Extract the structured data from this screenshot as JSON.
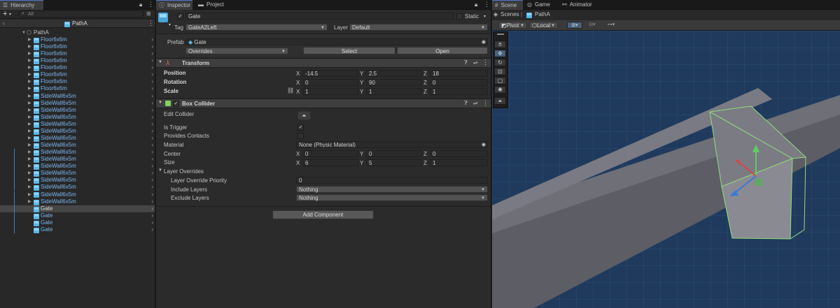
{
  "hierarchy": {
    "tab_label": "Hierarchy",
    "search_placeholder": "All",
    "scene_name": "PathA",
    "root": "PathA",
    "items": [
      {
        "label": "Floor6x6m"
      },
      {
        "label": "Floor6x6m"
      },
      {
        "label": "Floor6x6m"
      },
      {
        "label": "Floor6x6m"
      },
      {
        "label": "Floor6x6m"
      },
      {
        "label": "Floor6x6m"
      },
      {
        "label": "Floor6x6m"
      },
      {
        "label": "Floor6x6m"
      },
      {
        "label": "SideWall6x5m"
      },
      {
        "label": "SideWall6x5m"
      },
      {
        "label": "SideWall6x5m"
      },
      {
        "label": "SideWall6x5m"
      },
      {
        "label": "SideWall6x5m"
      },
      {
        "label": "SideWall6x5m"
      },
      {
        "label": "SideWall6x5m"
      },
      {
        "label": "SideWall6x5m"
      },
      {
        "label": "SideWall6x5m"
      },
      {
        "label": "SideWall6x5m"
      },
      {
        "label": "SideWall6x5m"
      },
      {
        "label": "SideWall6x5m"
      },
      {
        "label": "SideWall6x5m"
      },
      {
        "label": "SideWall6x5m"
      },
      {
        "label": "SideWall6x5m"
      },
      {
        "label": "SideWall6x5m"
      },
      {
        "label": "Gate"
      },
      {
        "label": "Gate"
      },
      {
        "label": "Gate"
      },
      {
        "label": "Gate"
      }
    ],
    "selected_index": 24
  },
  "tabs": {
    "inspector": "Inspector",
    "project": "Project",
    "scene": "Scene",
    "game": "Game",
    "animator": "Animator"
  },
  "inspector": {
    "object_name": "Gate",
    "static_label": "Static",
    "tag_label": "Tag",
    "tag_value": "GateA2Left",
    "layer_label": "Layer",
    "layer_value": "Default",
    "prefab_label": "Prefab",
    "prefab_value": "Gate",
    "overrides_label": "Overrides",
    "select_label": "Select",
    "open_label": "Open"
  },
  "transform": {
    "title": "Transform",
    "position_label": "Position",
    "rotation_label": "Rotation",
    "scale_label": "Scale",
    "position": {
      "x": "-14.5",
      "y": "2.5",
      "z": "18"
    },
    "rotation": {
      "x": "0",
      "y": "90",
      "z": "0"
    },
    "scale": {
      "x": "1",
      "y": "1",
      "z": "1"
    }
  },
  "box_collider": {
    "title": "Box Collider",
    "edit_collider": "Edit Collider",
    "is_trigger": "Is Trigger",
    "provides_contacts": "Provides Contacts",
    "material_label": "Material",
    "material_value": "None (Physic Material)",
    "center_label": "Center",
    "size_label": "Size",
    "center": {
      "x": "0",
      "y": "0",
      "z": "0"
    },
    "size": {
      "x": "6",
      "y": "5",
      "z": "1"
    },
    "layer_overrides": "Layer Overrides",
    "layer_override_priority": "Layer Override Priority",
    "priority_value": "0",
    "include_layers": "Include Layers",
    "include_value": "Nothing",
    "exclude_layers": "Exclude Layers",
    "exclude_value": "Nothing",
    "is_trigger_checked": true,
    "provides_contacts_checked": false
  },
  "add_component": "Add Component",
  "axes": {
    "x": "X",
    "y": "Y",
    "z": "Z"
  },
  "scene_view": {
    "breadcrumb_scenes": "Scenes",
    "breadcrumb_current": "PathA",
    "pivot": "Pivot",
    "local": "Local",
    "background_color": "#1f3a5c",
    "selection_color": "#8fe07a"
  }
}
